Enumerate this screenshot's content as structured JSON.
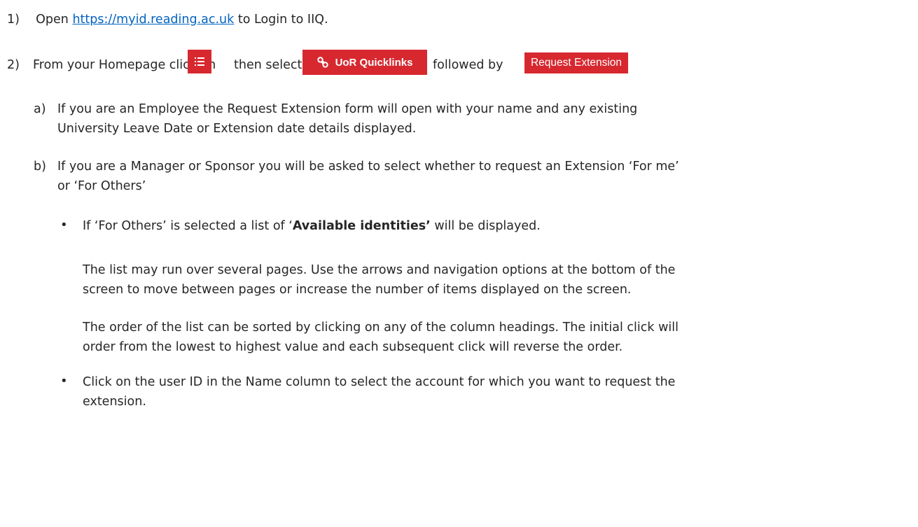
{
  "step1": {
    "num": "1)",
    "open": "Open",
    "url": "https://myid.reading.ac.uk",
    "rest": "to Login to IIQ."
  },
  "step2": {
    "num": "2)",
    "part1": "From your Homepage  click on",
    "part2": "then select",
    "quicklinks_label": "UoR Quicklinks",
    "part3": "followed by",
    "request_extension_label": "Request Extension"
  },
  "sub_a": {
    "letter": "a)",
    "line1": "If you are an Employee the Request Extension form will open with your name and any existing",
    "line2": "University Leave Date or Extension date details displayed."
  },
  "sub_b": {
    "letter": "b)",
    "line1": "If you are a Manager or Sponsor you will be asked to select whether to request an Extension ‘For me’",
    "line2": "or ‘For Others’"
  },
  "bullet1": {
    "pre": "If ‘For Others’ is selected a list of ‘",
    "bold": "Available identities’",
    "post": " will be displayed."
  },
  "para1": {
    "line1": "The list may run over several pages. Use the arrows and navigation options at the bottom of the",
    "line2": "screen to move between pages or increase the number of items displayed on the screen."
  },
  "para2": {
    "line1": "The order of the list can be sorted by clicking on any of the column headings. The initial click will",
    "line2": "order from the lowest to highest value and each subsequent click will reverse the order."
  },
  "bullet2": {
    "line1": "Click on the user ID in the Name column to select the account for which you want to request the",
    "line2": "extension."
  },
  "colors": {
    "brand_red": "#d7282f",
    "link": "#0563c1",
    "text": "#262626"
  },
  "icons": {
    "menu": "list-menu-icon",
    "quicklinks": "link-chain-icon"
  }
}
